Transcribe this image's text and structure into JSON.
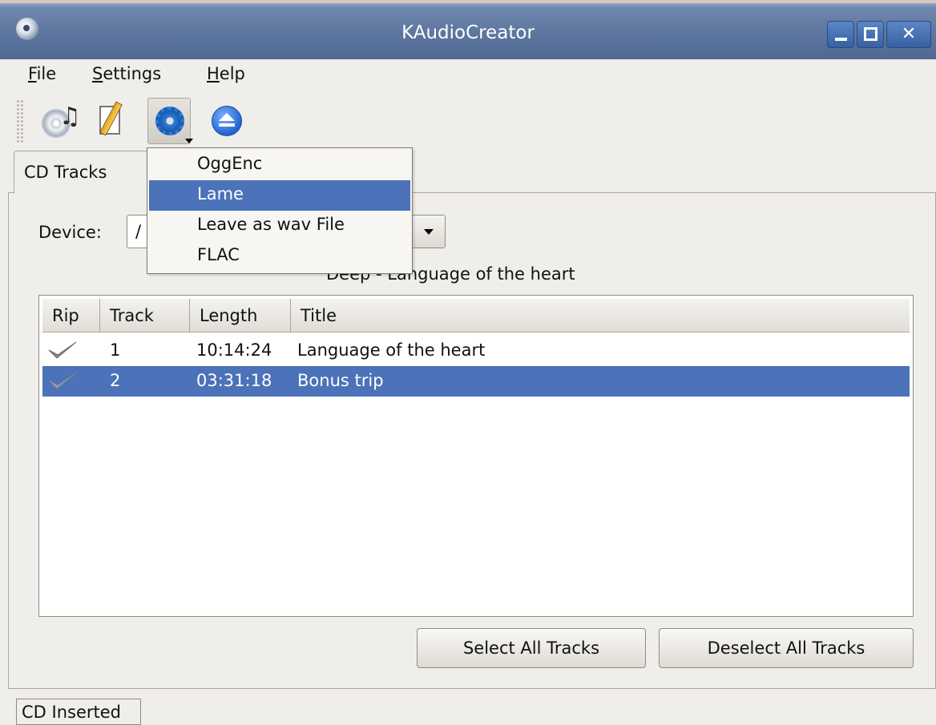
{
  "window": {
    "title": "KAudioCreator"
  },
  "menubar": {
    "file": "File",
    "settings": "Settings",
    "help": "Help"
  },
  "toolbar": {
    "buttons": [
      {
        "icon": "cd-music-icon",
        "pressed": false
      },
      {
        "icon": "edit-pencil-icon",
        "pressed": false
      },
      {
        "icon": "gear-icon",
        "pressed": true,
        "has_dropdown": true
      },
      {
        "icon": "eject-icon",
        "pressed": false
      }
    ]
  },
  "encoder_menu": {
    "items": [
      {
        "label": "OggEnc",
        "active": false
      },
      {
        "label": "Lame",
        "active": true
      },
      {
        "label": "Leave as wav File",
        "active": false
      },
      {
        "label": "FLAC",
        "active": false
      }
    ]
  },
  "tabs": [
    {
      "label": "CD Tracks",
      "active": true
    }
  ],
  "device": {
    "label": "Device:",
    "value": "/"
  },
  "album": {
    "label": "Deep - Language of the heart"
  },
  "table": {
    "columns": [
      "Rip",
      "Track",
      "Length",
      "Title"
    ],
    "rows": [
      {
        "rip": true,
        "track": "1",
        "length": "10:14:24",
        "title": "Language of the heart",
        "selected": false
      },
      {
        "rip": true,
        "track": "2",
        "length": "03:31:18",
        "title": "Bonus trip",
        "selected": true
      }
    ]
  },
  "buttons": {
    "select_all": "Select All Tracks",
    "deselect_all": "Deselect All Tracks"
  },
  "status": {
    "text": "CD Inserted"
  },
  "colors": {
    "selection": "#4c72b9",
    "titlebar": "#5f78a0"
  }
}
